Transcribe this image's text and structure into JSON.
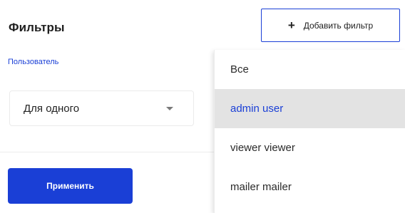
{
  "filters": {
    "title": "Фильтры",
    "add_filter_label": "Добавить фильтр",
    "add_filter_icon": "plus-icon"
  },
  "user_filter": {
    "label": "Пользователь",
    "selected_value": "Для одного",
    "caret_icon": "chevron-down-icon"
  },
  "apply_label": "Применить",
  "dropdown": {
    "options": [
      {
        "label": "Все",
        "selected": false
      },
      {
        "label": "admin user",
        "selected": true
      },
      {
        "label": "viewer viewer",
        "selected": false
      },
      {
        "label": "mailer mailer",
        "selected": false
      }
    ]
  },
  "colors": {
    "accent": "#1a3fd6",
    "selected_bg": "#e3e3e3"
  }
}
